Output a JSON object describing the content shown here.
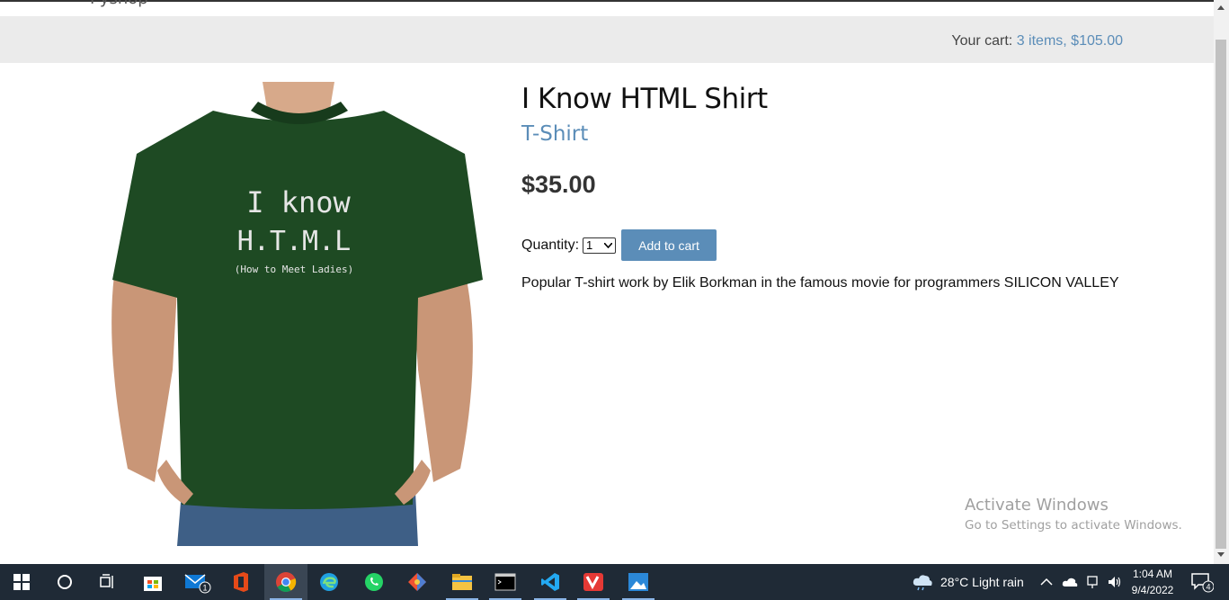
{
  "header": {
    "logo": "Pyshop"
  },
  "cart": {
    "label": "Your cart:",
    "summary": "3 items, $105.00"
  },
  "product": {
    "image_text_line1": "I know",
    "image_text_line2": "H.T.M.L",
    "image_text_line3": "(How to Meet Ladies)",
    "title": "I Know HTML Shirt",
    "category": "T-Shirt",
    "price": "$35.00",
    "quantity_label": "Quantity:",
    "quantity_value": "1",
    "add_button": "Add to cart",
    "description": "Popular T-shirt work by Elik Borkman in the famous movie for programmers SILICON VALLEY"
  },
  "watermark": {
    "line1": "Activate Windows",
    "line2": "Go to Settings to activate Windows."
  },
  "taskbar": {
    "apps": [
      "start",
      "search",
      "task-view",
      "store",
      "mail",
      "office",
      "chrome",
      "edge",
      "whatsapp",
      "git",
      "file-explorer",
      "terminal",
      "vscode",
      "vivaldi",
      "photos"
    ],
    "mail_badge": "1",
    "weather": "28°C  Light rain",
    "time": "1:04 AM",
    "date": "9/4/2022",
    "notification_count": "4"
  },
  "colors": {
    "accent": "#5b8db8",
    "shirt": "#1e4a23",
    "taskbar": "#1f2a36"
  }
}
